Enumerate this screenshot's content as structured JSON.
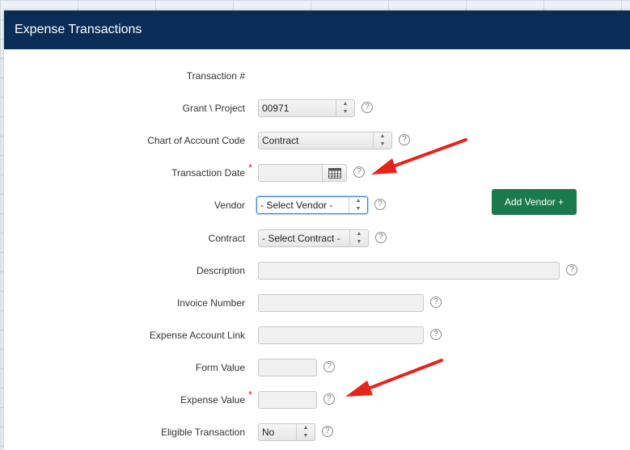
{
  "modal": {
    "title": "Expense Transactions"
  },
  "form": {
    "transaction_number": {
      "label": "Transaction #"
    },
    "grant_project": {
      "label": "Grant \\ Project",
      "value": "00971"
    },
    "chart_of_account_code": {
      "label": "Chart of Account Code",
      "value": "Contract"
    },
    "transaction_date": {
      "label": "Transaction Date",
      "required_mark": "*",
      "value": ""
    },
    "vendor": {
      "label": "Vendor",
      "value": "- Select Vendor -"
    },
    "contract": {
      "label": "Contract",
      "value": "- Select Contract -"
    },
    "description": {
      "label": "Description",
      "value": ""
    },
    "invoice_number": {
      "label": "Invoice Number",
      "value": ""
    },
    "expense_account_link": {
      "label": "Expense Account Link",
      "value": ""
    },
    "form_value": {
      "label": "Form Value",
      "value": ""
    },
    "expense_value": {
      "label": "Expense Value",
      "required_mark": "*",
      "value": ""
    },
    "eligible_transaction": {
      "label": "Eligible Transaction",
      "value": "No"
    }
  },
  "buttons": {
    "add_vendor": "Add Vendor +"
  },
  "help_glyph": "?",
  "colors": {
    "header_bg": "#0a2d57",
    "add_vendor_bg": "#1b7a4c",
    "annotation_arrow": "#e8231b",
    "required": "#e02020"
  },
  "icons": [
    "calendar-icon",
    "help-icon",
    "select-arrows-icon",
    "plus-icon",
    "annotation-arrow"
  ]
}
